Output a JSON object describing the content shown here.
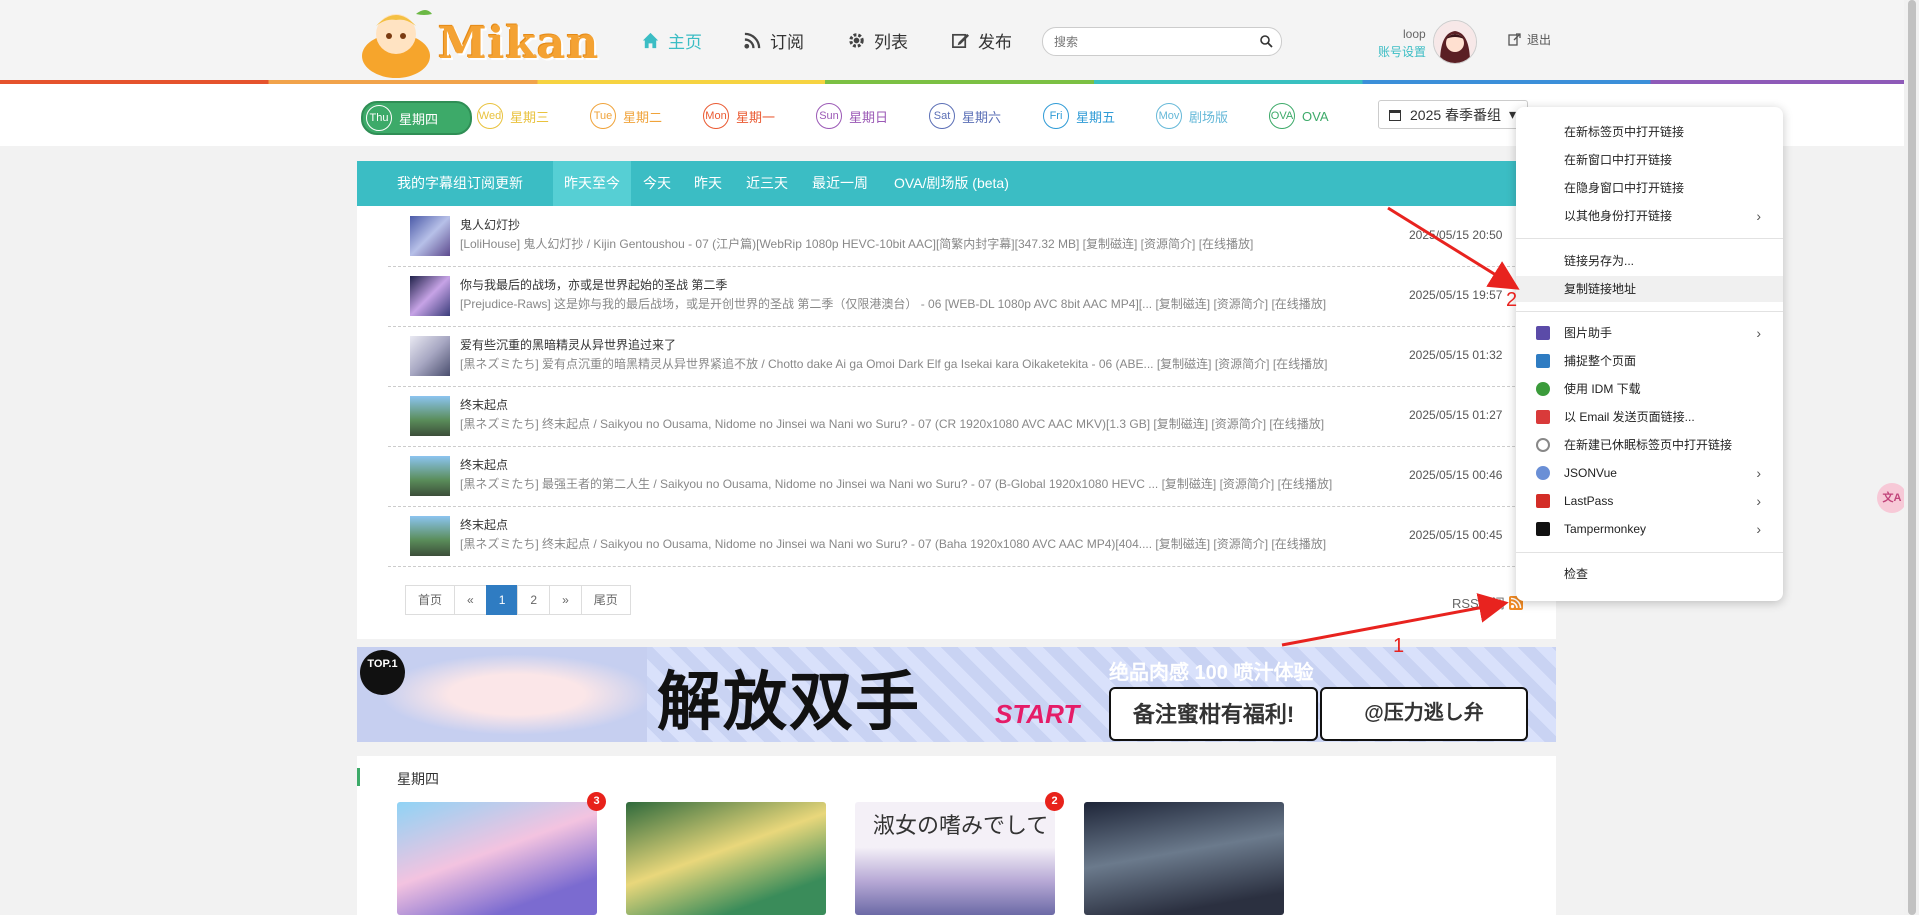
{
  "header": {
    "logo_text": "Mikan",
    "nav": [
      {
        "label": "主页",
        "icon": "home-icon"
      },
      {
        "label": "订阅",
        "icon": "rss-icon"
      },
      {
        "label": "列表",
        "icon": "gear-icon"
      },
      {
        "label": "发布",
        "icon": "edit-icon"
      }
    ],
    "search_placeholder": "搜索",
    "user_name": "loop",
    "account_link": "账号设置",
    "logout": "退出"
  },
  "weekdays": [
    {
      "badge": "Thu",
      "label": "星期四",
      "active": true
    },
    {
      "badge": "Wed",
      "label": "星期三",
      "color": "#e9c23d"
    },
    {
      "badge": "Tue",
      "label": "星期二",
      "color": "#f0a33a"
    },
    {
      "badge": "Mon",
      "label": "星期一",
      "color": "#ea5a32"
    },
    {
      "badge": "Sun",
      "label": "星期日",
      "color": "#9b59b6"
    },
    {
      "badge": "Sat",
      "label": "星期六",
      "color": "#5b6fb6"
    },
    {
      "badge": "Fri",
      "label": "星期五",
      "color": "#2f9bd6"
    },
    {
      "badge": "Mov",
      "label": "剧场版",
      "color": "#65b8d8"
    },
    {
      "badge": "OVA",
      "label": "OVA",
      "color": "#3daa69"
    }
  ],
  "season": "2025 春季番组",
  "tabs": {
    "title": "我的字幕组订阅更新",
    "items": [
      "昨天至今",
      "今天",
      "昨天",
      "近三天",
      "最近一周",
      "OVA/剧场版 (beta)"
    ]
  },
  "updates": [
    {
      "title": "鬼人幻灯抄",
      "desc": "[LoliHouse] 鬼人幻灯抄 / Kijin Gentoushou - 07 (江户篇)[WebRip 1080p HEVC-10bit AAC][简繁内封字幕][347.32 MB] [复制磁连] [资源简介] [在线播放]",
      "time": "2025/05/15 20:50"
    },
    {
      "title": "你与我最后的战场，亦或是世界起始的圣战 第二季",
      "desc": "[Prejudice-Raws] 这是妳与我的最后战场，或是开创世界的圣战 第二季（仅限港澳台） - 06 [WEB-DL 1080p AVC 8bit AAC MP4][...   [复制磁连] [资源简介] [在线播放]",
      "time": "2025/05/15 19:57"
    },
    {
      "title": "爱有些沉重的黑暗精灵从异世界追过来了",
      "desc": "[黒ネズミたち] 爱有点沉重的暗黑精灵从异世界紧追不放 / Chotto dake Ai ga Omoi Dark Elf ga Isekai kara Oikaketekita - 06 (ABE...   [复制磁连] [资源简介] [在线播放]",
      "time": "2025/05/15 01:32"
    },
    {
      "title": "终末起点",
      "desc": "[黒ネズミたち] 终末起点 / Saikyou no Ousama, Nidome no Jinsei wa Nani wo Suru? - 07 (CR 1920x1080 AVC AAC MKV)[1.3 GB] [复制磁连] [资源简介] [在线播放]",
      "time": "2025/05/15 01:27"
    },
    {
      "title": "终末起点",
      "desc": "[黒ネズミたち] 最强王者的第二人生 / Saikyou no Ousama, Nidome no Jinsei wa Nani wo Suru? - 07 (B-Global 1920x1080 HEVC ...   [复制磁连] [资源简介] [在线播放]",
      "time": "2025/05/15 00:46"
    },
    {
      "title": "终末起点",
      "desc": "[黒ネズミたち] 终末起点 / Saikyou no Ousama, Nidome no Jinsei wa Nani wo Suru? - 07 (Baha 1920x1080 AVC AAC MP4)[404....   [复制磁连] [资源简介] [在线播放]",
      "time": "2025/05/15 00:45"
    }
  ],
  "pager": [
    "首页",
    "«",
    "1",
    "2",
    "»",
    "尾页"
  ],
  "rss_label": "RSS订阅",
  "banner": {
    "top1": "TOP.1",
    "main": "解放双手",
    "start": "START",
    "r1": "绝品肉感 100 喷汁体验",
    "box1": "备注蜜柑有福利!",
    "box2": "@压力逃し弁"
  },
  "section_title": "星期四",
  "cards": [
    {
      "badge": "3"
    },
    {
      "badge": ""
    },
    {
      "badge": "2",
      "title": "淑女の嗜みでして"
    },
    {
      "badge": ""
    }
  ],
  "context_menu": {
    "group1": [
      "在新标签页中打开链接",
      "在新窗口中打开链接",
      "在隐身窗口中打开链接",
      "以其他身份打开链接"
    ],
    "group2": [
      "链接另存为...",
      "复制链接地址"
    ],
    "group3": [
      {
        "label": "图片助手",
        "icon": "image-helper-icon",
        "color": "#5b4ba8",
        "submenu": true
      },
      {
        "label": "捕捉整个页面",
        "icon": "capture-icon",
        "color": "#2f7cc2",
        "submenu": false
      },
      {
        "label": "使用 IDM 下载",
        "icon": "idm-icon",
        "color": "#3b9b3b",
        "submenu": false
      },
      {
        "label": "以 Email 发送页面链接...",
        "icon": "email-icon",
        "color": "#d93a3a",
        "submenu": false
      },
      {
        "label": "在新建已休眠标签页中打开链接",
        "icon": "power-icon",
        "color": "#888888",
        "submenu": false
      },
      {
        "label": "JSONVue",
        "icon": "jsonvue-icon",
        "color": "#6a8fd6",
        "submenu": true
      },
      {
        "label": "LastPass",
        "icon": "lastpass-icon",
        "color": "#d32d27",
        "submenu": true
      },
      {
        "label": "Tampermonkey",
        "icon": "tampermonkey-icon",
        "color": "#111111",
        "submenu": true
      }
    ],
    "inspect": "检查"
  },
  "annotations": {
    "one": "1",
    "two": "2"
  },
  "side_widget": "文A"
}
